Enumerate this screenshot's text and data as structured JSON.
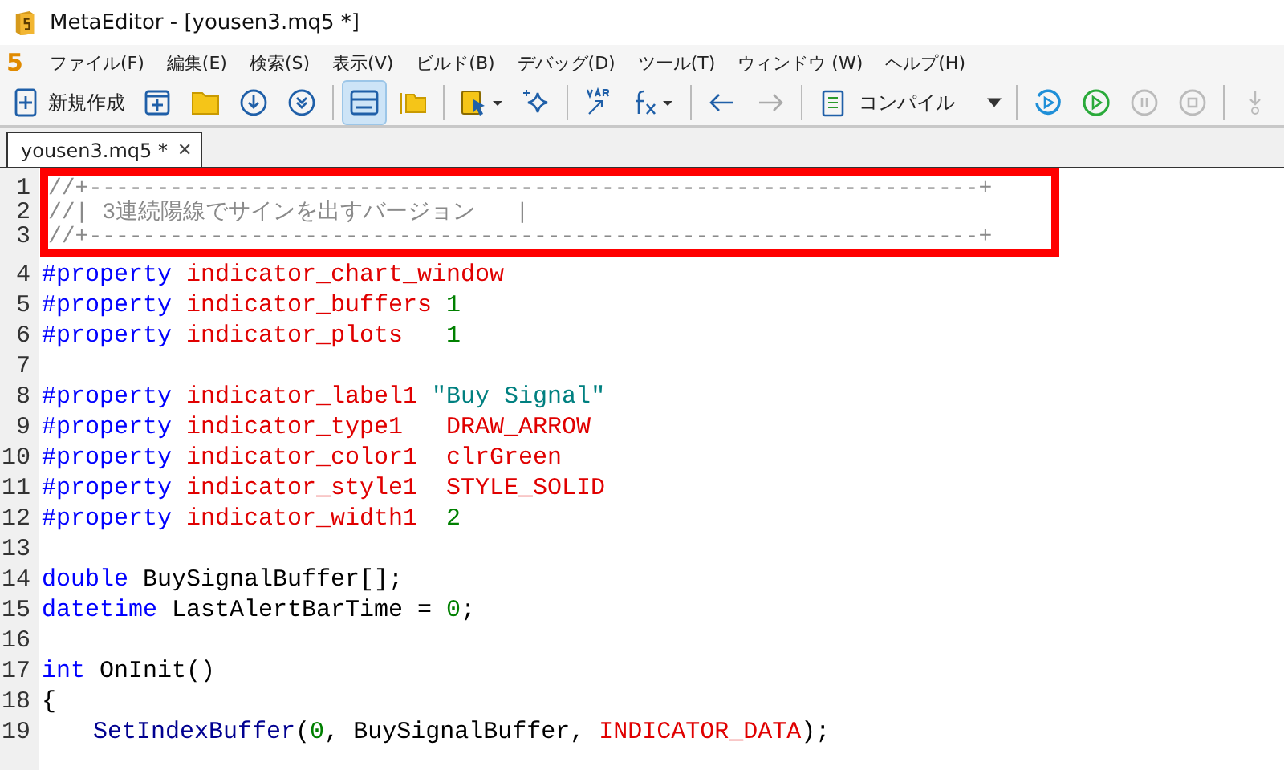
{
  "window": {
    "title": "MetaEditor - [yousen3.mq5 *]"
  },
  "menu": {
    "logo": "5",
    "items": [
      "ファイル(F)",
      "編集(E)",
      "検索(S)",
      "表示(V)",
      "ビルド(B)",
      "デバッグ(D)",
      "ツール(T)",
      "ウィンドウ (W)",
      "ヘルプ(H)"
    ]
  },
  "toolbar": {
    "new_label": "新規作成",
    "layout_toggle_on": true,
    "compile_label": "コンパイル"
  },
  "tabs": [
    {
      "label": "yousen3.mq5 *",
      "close": "✕",
      "selected": true
    }
  ],
  "highlight_frame": {
    "lines": [
      {
        "number": "1",
        "tokens": [
          {
            "kind": "comment",
            "text": "//+------------------------------------------------------------------+"
          }
        ]
      },
      {
        "number": "2",
        "tokens": [
          {
            "kind": "comment",
            "text": "//| 3連続陽線でサインを出すバージョン   |"
          }
        ]
      },
      {
        "number": "3",
        "tokens": [
          {
            "kind": "comment",
            "text": "//+------------------------------------------------------------------+"
          }
        ]
      }
    ]
  },
  "lines": [
    {
      "number": "4",
      "tokens": [
        {
          "kind": "keyword",
          "text": "#property "
        },
        {
          "kind": "constant",
          "text": "indicator_chart_window"
        }
      ]
    },
    {
      "number": "5",
      "tokens": [
        {
          "kind": "keyword",
          "text": "#property "
        },
        {
          "kind": "constant",
          "text": "indicator_buffers "
        },
        {
          "kind": "number",
          "text": "1"
        }
      ]
    },
    {
      "number": "6",
      "tokens": [
        {
          "kind": "keyword",
          "text": "#property "
        },
        {
          "kind": "constant",
          "text": "indicator_plots   "
        },
        {
          "kind": "number",
          "text": "1"
        }
      ]
    },
    {
      "number": "7"
    },
    {
      "number": "8",
      "tokens": [
        {
          "kind": "keyword",
          "text": "#property "
        },
        {
          "kind": "constant",
          "text": "indicator_label1 "
        },
        {
          "kind": "string",
          "text": "\"Buy Signal\""
        }
      ]
    },
    {
      "number": "9",
      "tokens": [
        {
          "kind": "keyword",
          "text": "#property "
        },
        {
          "kind": "constant",
          "text": "indicator_type1   DRAW_ARROW"
        }
      ]
    },
    {
      "number": "10",
      "tokens": [
        {
          "kind": "keyword",
          "text": "#property "
        },
        {
          "kind": "constant",
          "text": "indicator_color1  clrGreen"
        }
      ]
    },
    {
      "number": "11",
      "tokens": [
        {
          "kind": "keyword",
          "text": "#property "
        },
        {
          "kind": "constant",
          "text": "indicator_style1  STYLE_SOLID"
        }
      ]
    },
    {
      "number": "12",
      "tokens": [
        {
          "kind": "keyword",
          "text": "#property "
        },
        {
          "kind": "constant",
          "text": "indicator_width1  "
        },
        {
          "kind": "number",
          "text": "2"
        }
      ]
    },
    {
      "number": "13"
    },
    {
      "number": "14",
      "tokens": [
        {
          "kind": "keyword",
          "text": "double "
        },
        {
          "kind": "plain",
          "text": "BuySignalBuffer[];"
        }
      ]
    },
    {
      "number": "15",
      "tokens": [
        {
          "kind": "keyword",
          "text": "datetime "
        },
        {
          "kind": "plain",
          "text": "LastAlertBarTime = "
        },
        {
          "kind": "number",
          "text": "0"
        },
        {
          "kind": "plain",
          "text": ";"
        }
      ]
    },
    {
      "number": "16"
    },
    {
      "number": "17",
      "tokens": [
        {
          "kind": "keyword",
          "text": "int "
        },
        {
          "kind": "plain",
          "text": "OnInit()"
        }
      ]
    },
    {
      "number": "18",
      "tokens": [
        {
          "kind": "plain",
          "text": "{"
        }
      ]
    },
    {
      "number": "19",
      "indented": true,
      "tokens": [
        {
          "kind": "function",
          "text": "SetIndexBuffer"
        },
        {
          "kind": "plain",
          "text": "("
        },
        {
          "kind": "number",
          "text": "0"
        },
        {
          "kind": "plain",
          "text": ", BuySignalBuffer, "
        },
        {
          "kind": "constant",
          "text": "INDICATOR_DATA"
        },
        {
          "kind": "plain",
          "text": ");"
        }
      ]
    }
  ]
}
